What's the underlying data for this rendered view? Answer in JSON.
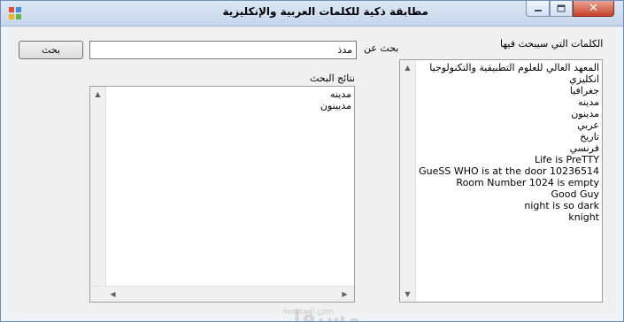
{
  "window": {
    "title": "مطابقة ذكية للكلمات العربية والإنكليزية",
    "close_glyph": "✕"
  },
  "search": {
    "button_label": "بحث",
    "input_value": "مدذ",
    "input_label": "بحث عن"
  },
  "source": {
    "label": "الكلمات التي سيبحث فيها",
    "items": [
      "المعهد العالي للعلوم التطبيقية والتكنولوجيا",
      "انكليزي",
      "جغرافيا",
      "مدينه",
      "مدينون",
      "عربي",
      "تاريخ",
      "فرنسي",
      "Life is PreTTY",
      "GueSS WHO is at the door 10236514",
      "Room Number 1024 is empty",
      "Good Guy",
      "night is so dark",
      "knight"
    ]
  },
  "results": {
    "label": "نتائج البحث",
    "items": [
      "مدينه",
      "مديينون"
    ]
  },
  "watermark": {
    "brand": "مستقل",
    "url": "mostaql.com"
  },
  "colors": {
    "title_bar": "#c5d6ec",
    "close_button": "#c7432b",
    "window_bg": "#f0f0f0"
  }
}
